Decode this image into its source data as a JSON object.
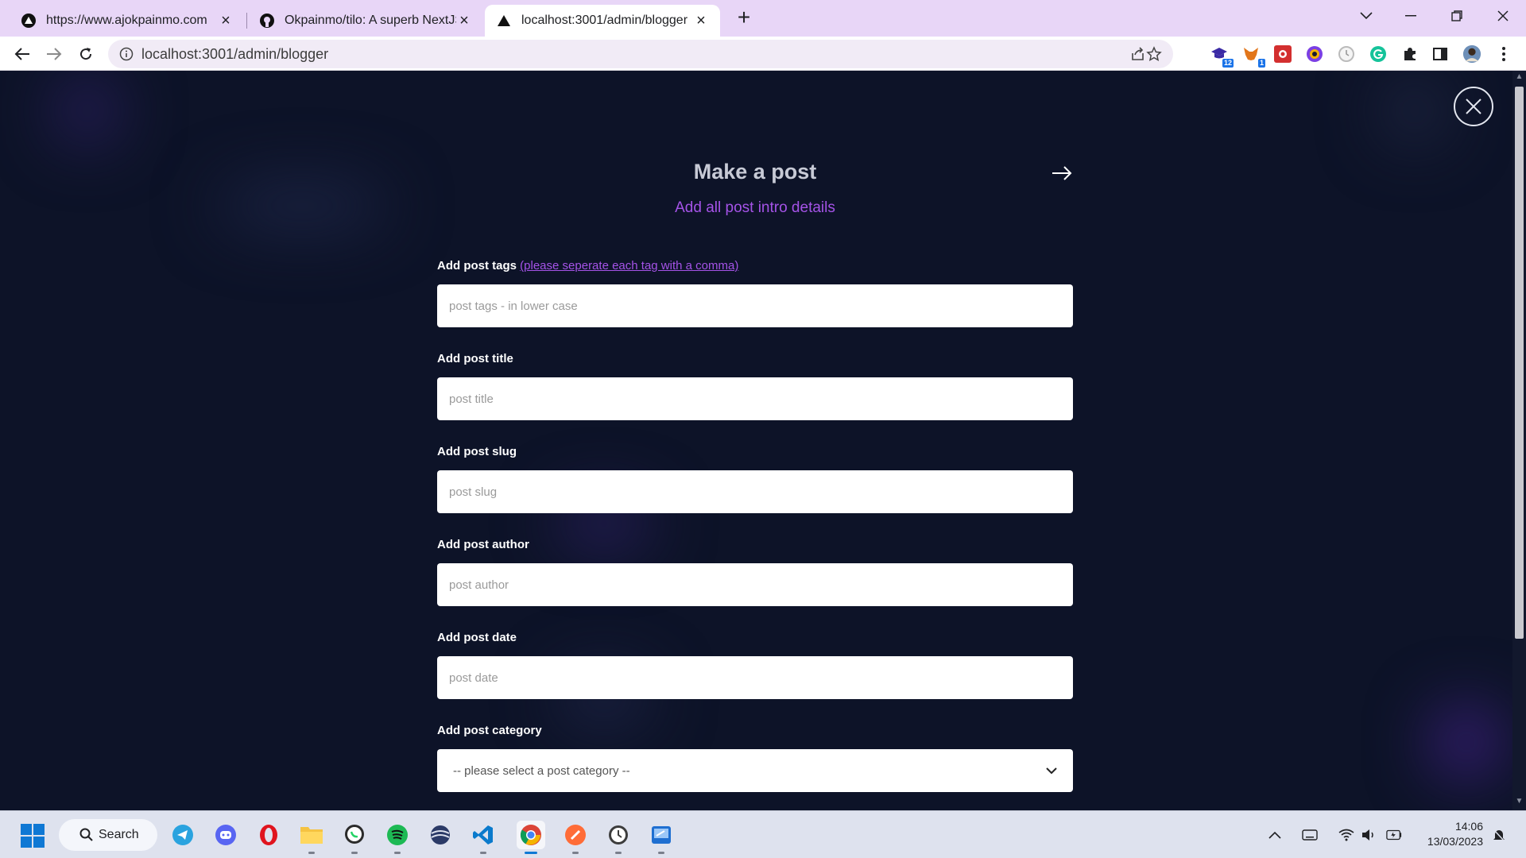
{
  "browser": {
    "tabs": [
      {
        "title": "https://www.ajokpainmo.com",
        "favicon": "triangle-logo-icon",
        "active": false
      },
      {
        "title": "Okpainmo/tilo: A superb NextJS",
        "favicon": "github-icon",
        "active": false
      },
      {
        "title": "localhost:3001/admin/blogger",
        "favicon": "triangle-logo-icon",
        "active": true
      }
    ],
    "new_tab_symbol": "+",
    "url": "localhost:3001/admin/blogger",
    "extensions": [
      {
        "name": "hat-extension-icon",
        "badge": "12"
      },
      {
        "name": "fox-extension-icon",
        "badge": "1"
      },
      {
        "name": "red-extension-icon"
      },
      {
        "name": "circle-extension-icon"
      },
      {
        "name": "timer-extension-icon"
      },
      {
        "name": "grammarly-icon"
      },
      {
        "name": "puzzle-icon"
      },
      {
        "name": "sidepanel-icon"
      },
      {
        "name": "profile-avatar"
      },
      {
        "name": "kebab-menu-icon"
      }
    ]
  },
  "page": {
    "title": "Make a post",
    "subtitle": "Add all post intro details",
    "fields": [
      {
        "label": "Add post tags",
        "hint": "(please seperate each tag with a comma)",
        "placeholder": "post tags - in lower case",
        "value": ""
      },
      {
        "label": "Add post title",
        "placeholder": "post title",
        "value": ""
      },
      {
        "label": "Add post slug",
        "placeholder": "post slug",
        "value": ""
      },
      {
        "label": "Add post author",
        "placeholder": "post author",
        "value": ""
      },
      {
        "label": "Add post date",
        "placeholder": "post date",
        "value": ""
      }
    ],
    "category": {
      "label": "Add post category",
      "selected": "-- please select a post category --"
    },
    "colors": {
      "background": "#0d1328",
      "accent": "#a553e8"
    }
  },
  "taskbar": {
    "search_label": "Search",
    "apps": [
      "telegram-icon",
      "discord-icon",
      "opera-icon",
      "file-explorer-icon",
      "whatsapp-icon",
      "spotify-icon",
      "browser-globe-icon",
      "vscode-icon",
      "chrome-icon",
      "postman-icon",
      "clock-app-icon",
      "remote-desktop-icon"
    ],
    "time": "14:06",
    "date": "13/03/2023"
  }
}
